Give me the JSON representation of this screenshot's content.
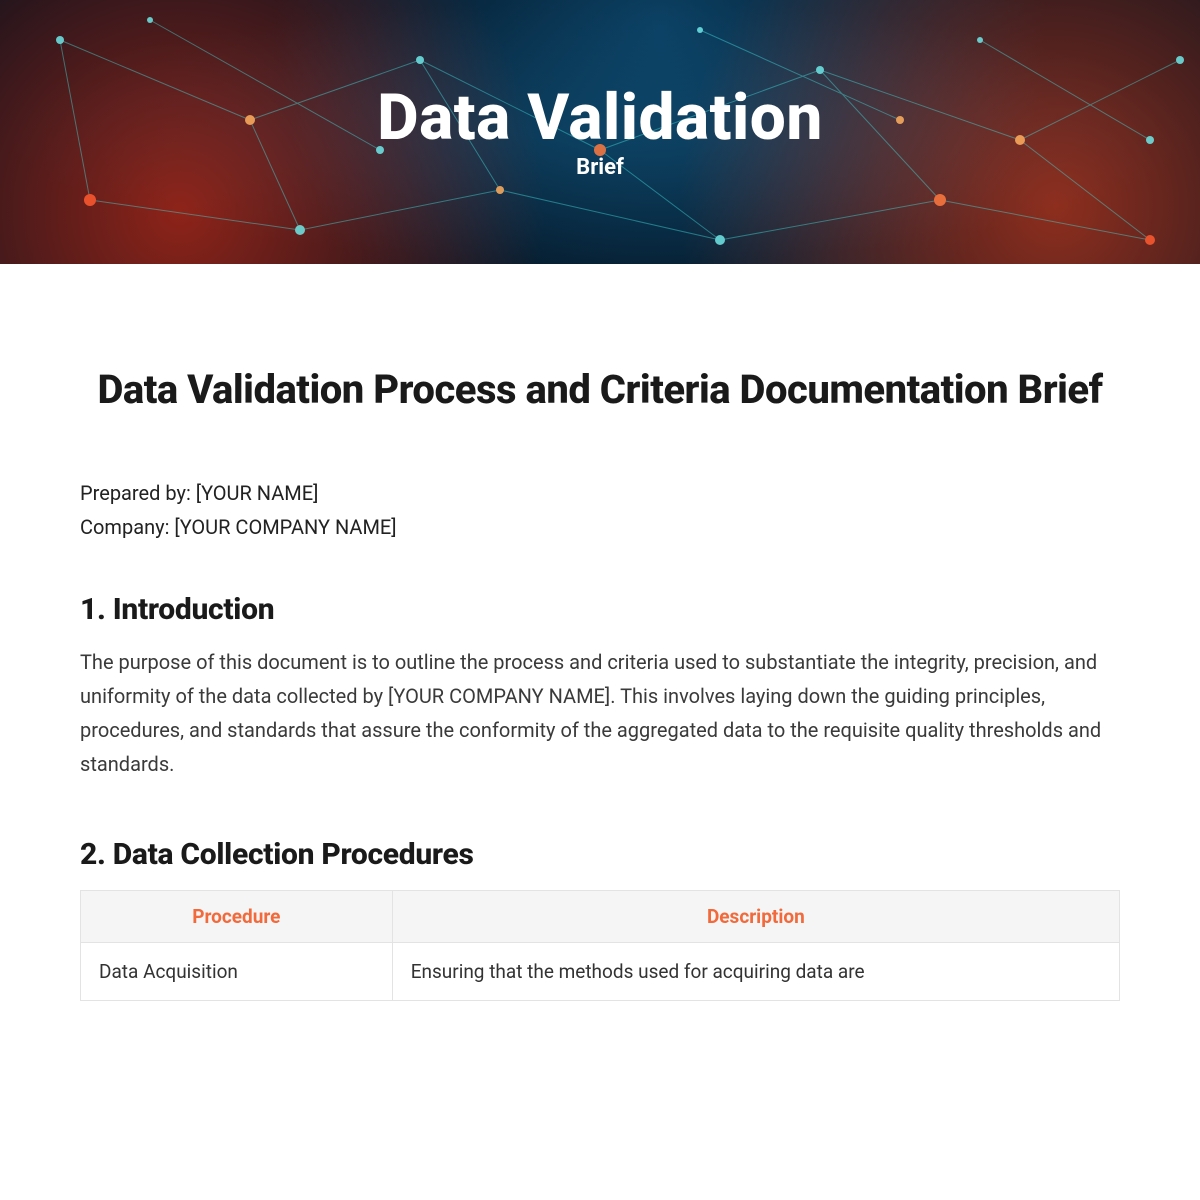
{
  "hero": {
    "title": "Data Validation",
    "subtitle": "Brief"
  },
  "doc": {
    "title": "Data Validation Process and Criteria Documentation Brief",
    "prepared_by_label": "Prepared by: ",
    "prepared_by_value": "[YOUR NAME]",
    "company_label": "Company: ",
    "company_value": "[YOUR COMPANY NAME]"
  },
  "sections": {
    "s1": {
      "heading": "1. Introduction",
      "body": "The purpose of this document is to outline the process and criteria used to substantiate the integrity, precision, and uniformity of the data collected by [YOUR COMPANY NAME]. This involves laying down the guiding principles, procedures, and standards that assure the conformity of the aggregated data to the requisite quality thresholds and standards."
    },
    "s2": {
      "heading": "2. Data Collection Procedures",
      "table": {
        "col1": "Procedure",
        "col2": "Description",
        "rows": [
          {
            "c1": "Data Acquisition",
            "c2": "Ensuring that the methods used for acquiring data are"
          }
        ]
      }
    }
  }
}
